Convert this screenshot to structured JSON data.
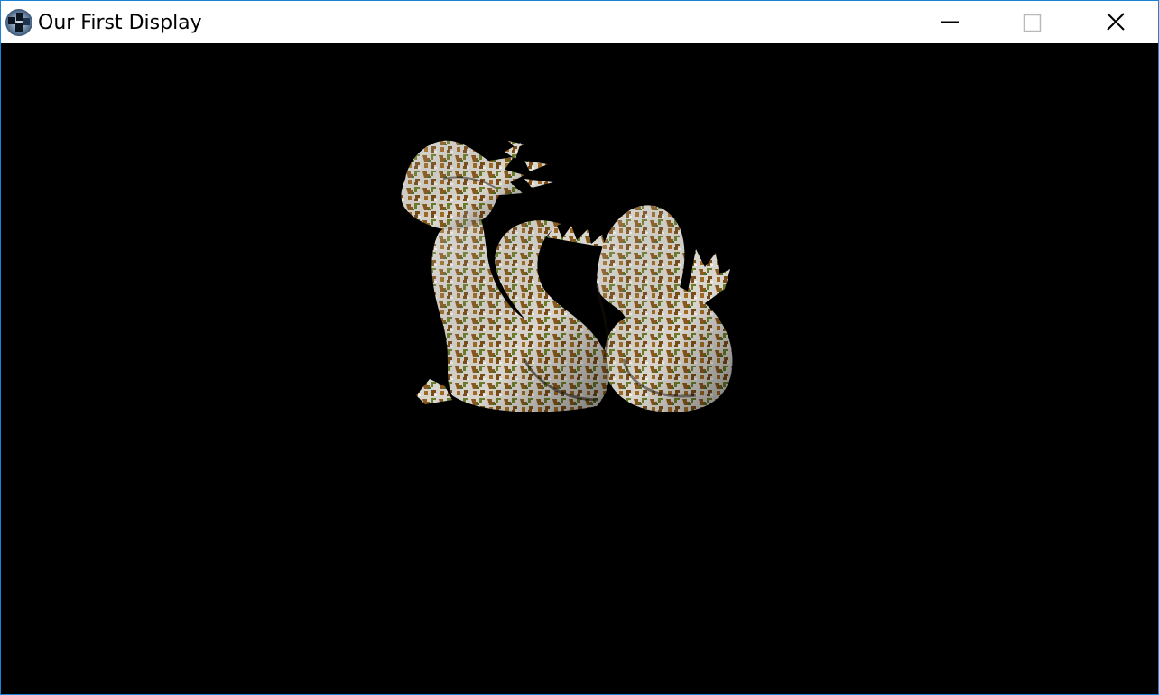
{
  "window": {
    "title": "Our First Display",
    "accent_color": "#1883d7"
  },
  "titlebar": {
    "app_icon": "app-icon",
    "controls": [
      {
        "name": "minimize-icon"
      },
      {
        "name": "maximize-icon"
      },
      {
        "name": "close-icon"
      }
    ]
  },
  "canvas": {
    "background_color": "#000000",
    "model_icon": "textured-dragon-model"
  }
}
